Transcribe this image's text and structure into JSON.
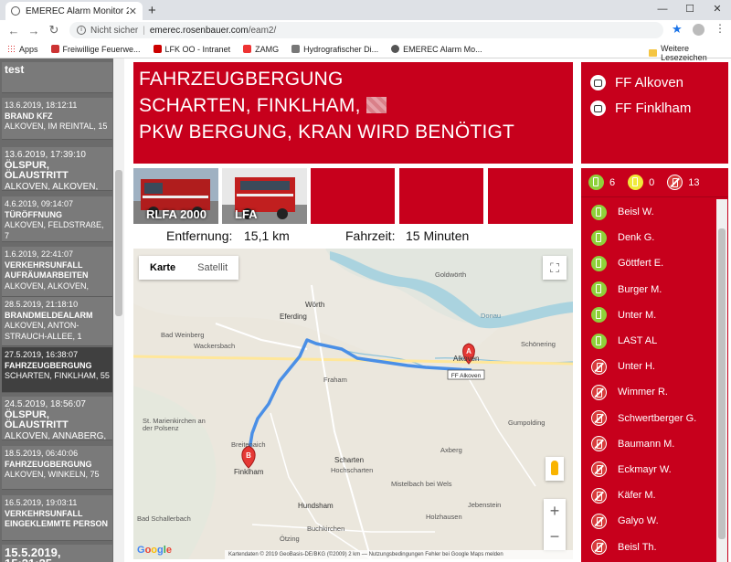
{
  "browser": {
    "tab_title": "EMEREC Alarm Monitor 2",
    "not_secure": "Nicht sicher",
    "url_host": "emerec.rosenbauer.com",
    "url_path": "/eam2/",
    "bookmarks": [
      {
        "label": "Apps",
        "color": "#d33"
      },
      {
        "label": "Freiwillige Feuerwe...",
        "color": "#c33"
      },
      {
        "label": "LFK OO - Intranet",
        "color": "#c00"
      },
      {
        "label": "ZAMG",
        "color": "#e33"
      },
      {
        "label": "Hydrografischer Di...",
        "color": "#777"
      },
      {
        "label": "EMEREC Alarm Mo...",
        "color": "#555"
      }
    ],
    "other_bookmarks": "Weitere Lesezeichen"
  },
  "alarms": [
    {
      "date": "",
      "title": "test",
      "addr": ""
    },
    {
      "date": "13.6.2019, 18:12:11",
      "title": "BRAND KFZ",
      "addr": "ALKOVEN, IM REINTAL, 15"
    },
    {
      "date": "13.6.2019, 17:39:10",
      "title": "ÖLSPUR, ÖLAUSTRITT",
      "addr": "ALKOVEN, ALKOVEN,"
    },
    {
      "date": "4.6.2019, 09:14:07",
      "title": "TÜRÖFFNUNG",
      "addr": "ALKOVEN, FELDSTRAßE, 7"
    },
    {
      "date": "1.6.2019, 22:41:07",
      "title": "VERKEHRSUNFALL AUFRÄUMARBEITEN",
      "addr": "ALKOVEN, ALKOVEN,"
    },
    {
      "date": "28.5.2019, 21:18:10",
      "title": "BRANDMELDEALARM",
      "addr": "ALKOVEN, ANTON-STRAUCH-ALLEE, 1"
    },
    {
      "date": "27.5.2019, 16:38:07",
      "title": "FAHRZEUGBERGUNG",
      "addr": "SCHARTEN, FINKLHAM, 55"
    },
    {
      "date": "24.5.2019, 18:56:07",
      "title": "ÖLSPUR, ÖLAUSTRITT",
      "addr": "ALKOVEN, ANNABERG,"
    },
    {
      "date": "18.5.2019, 06:40:06",
      "title": "FAHRZEUGBERGUNG",
      "addr": "ALKOVEN, WINKELN, 75"
    },
    {
      "date": "16.5.2019, 19:03:11",
      "title": "VERKEHRSUNFALL EINGEKLEMMTE PERSON",
      "addr": ""
    },
    {
      "date": "15.5.2019, 15:21:25",
      "title": "",
      "addr": ""
    }
  ],
  "header": {
    "line1": "FAHRZEUGBERGUNG",
    "line2": "SCHARTEN, FINKLHAM,",
    "line3": "PKW BERGUNG, KRAN WIRD BENÖTIGT"
  },
  "vehicles": [
    {
      "label": "RLFA 2000"
    },
    {
      "label": "LFA"
    },
    {
      "label": ""
    },
    {
      "label": ""
    },
    {
      "label": ""
    }
  ],
  "info": {
    "distance_label": "Entfernung:",
    "distance_value": "15,1 km",
    "drive_label": "Fahrzeit:",
    "drive_value": "15 Minuten"
  },
  "map": {
    "type_map": "Karte",
    "type_sat": "Satellit",
    "marker_a": "A",
    "marker_b": "B",
    "marker_a_label": "FF Alkoven",
    "footer": "Kartendaten © 2019 GeoBasis-DE/BKG (©2009)   2 km ⎯⎯   Nutzungsbedingungen   Fehler bei Google Maps melden",
    "google": "Google",
    "towns": [
      "Goldwörth",
      "Wörth",
      "Eferding",
      "Bad Weinberg",
      "Wackersbach",
      "Fraham",
      "Alkoven",
      "Schönering",
      "St. Marienkirchen an der Polsenz",
      "Breitenaich",
      "Finklham",
      "Scharten",
      "Hochscharten",
      "Axberg",
      "Gumpolding",
      "Mistelbach bei Wels",
      "Hundsham",
      "Bad Schallerbach",
      "Buchkirchen",
      "Holzhausen",
      "Jebenstein",
      "Ötzing",
      "Donau"
    ],
    "roads": [
      "130",
      "129",
      "130",
      "129",
      "125",
      "129",
      "133",
      "133",
      "114",
      "134",
      "135"
    ]
  },
  "units": [
    {
      "label": "FF Alkoven"
    },
    {
      "label": "FF Finklham"
    }
  ],
  "crew_summary": {
    "green": "6",
    "yellow": "0",
    "red": "13"
  },
  "crew": [
    {
      "name": "Beisl W.",
      "status": "green"
    },
    {
      "name": "Denk G.",
      "status": "green"
    },
    {
      "name": "Göttfert E.",
      "status": "green"
    },
    {
      "name": "Burger M.",
      "status": "green"
    },
    {
      "name": "Unter M.",
      "status": "green"
    },
    {
      "name": "LAST AL",
      "status": "green"
    },
    {
      "name": "Unter H.",
      "status": "red"
    },
    {
      "name": "Wimmer R.",
      "status": "red"
    },
    {
      "name": "Schwertberger G.",
      "status": "red"
    },
    {
      "name": "Baumann M.",
      "status": "red"
    },
    {
      "name": "Eckmayr W.",
      "status": "red"
    },
    {
      "name": "Käfer M.",
      "status": "red"
    },
    {
      "name": "Galyo W.",
      "status": "red"
    },
    {
      "name": "Beisl Th.",
      "status": "red"
    }
  ],
  "colors": {
    "brand_red": "#c7001c",
    "route_blue": "#4a8fe6"
  }
}
